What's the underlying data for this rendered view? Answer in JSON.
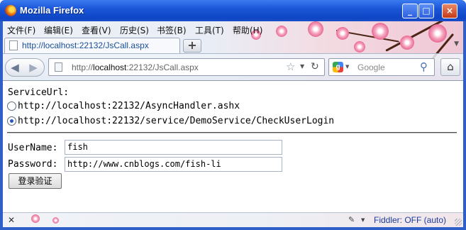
{
  "window": {
    "title": "Mozilla Firefox"
  },
  "menubar": {
    "items": [
      "文件(F)",
      "编辑(E)",
      "查看(V)",
      "历史(S)",
      "书签(B)",
      "工具(T)",
      "帮助(H)"
    ]
  },
  "tabs": [
    {
      "label": "http://localhost:22132/JsCall.aspx"
    }
  ],
  "newtab": {
    "symbol": "+"
  },
  "urlbar": {
    "prefix": "http://",
    "host": "localhost",
    "rest": ":22132/JsCall.aspx"
  },
  "search": {
    "engine": "Google",
    "placeholder": "Google"
  },
  "page": {
    "service_label": "ServiceUrl:",
    "service_options": [
      {
        "label": "http://localhost:22132/AsyncHandler.ashx",
        "checked": false
      },
      {
        "label": "http://localhost:22132/service/DemoService/CheckUserLogin",
        "checked": true
      }
    ],
    "username_label": "UserName:",
    "username_value": "fish",
    "password_label": "Password:",
    "password_value": "http://www.cnblogs.com/fish-li",
    "submit_label": "登录验证"
  },
  "statusbar": {
    "fiddler": "Fiddler: OFF (auto)"
  },
  "colors": {
    "titlebar": "#1b56d8",
    "accent_link": "#1a4f9a",
    "radio_dot": "#2a55c8",
    "fiddler_text": "#1c3c9c"
  }
}
